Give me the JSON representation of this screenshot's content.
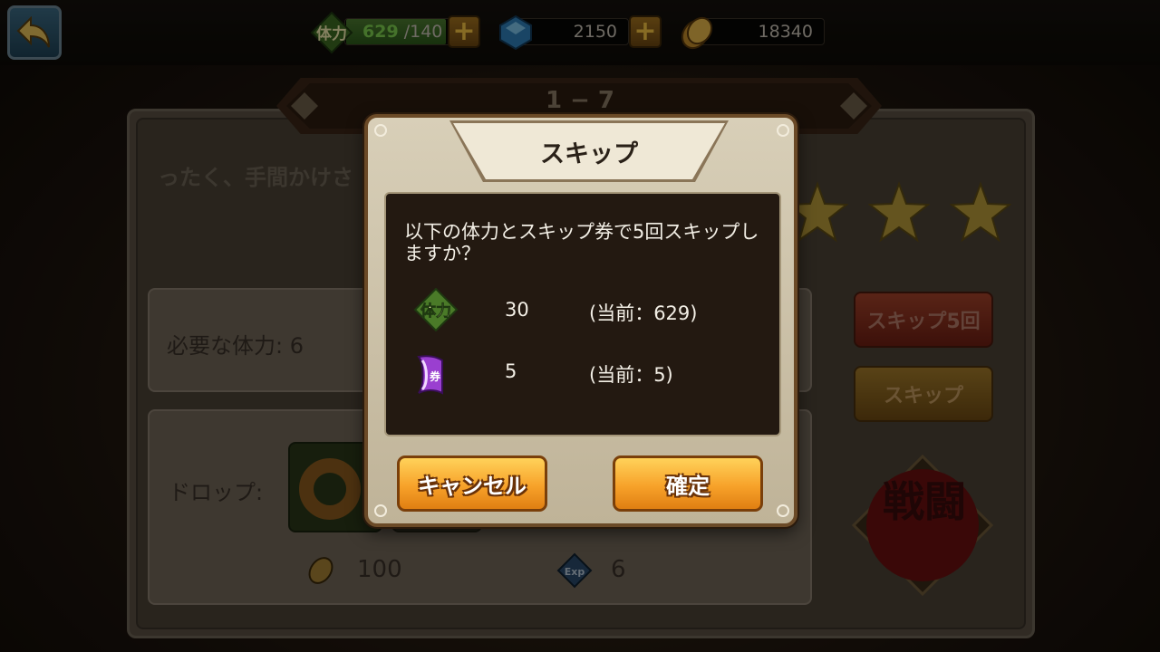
{
  "topbar": {
    "back_label": "↩",
    "stamina_current": "629",
    "stamina_max": "/140",
    "gems": "2150",
    "coins": "18340",
    "plus": "+",
    "stamina_icon_text": "体力"
  },
  "stage": {
    "number": "1 − 7",
    "description": "ったく、手間かけさ",
    "required_label": "必要な体力: 6",
    "drop_label": "ドロップ:",
    "gold_reward": "100",
    "exp_reward": "6",
    "stars": 3,
    "skip5_label": "スキップ5回",
    "skip_label": "スキップ",
    "battle_label": "戦闘"
  },
  "dialog": {
    "title": "スキップ",
    "message": "以下の体力とスキップ券で5回スキップしますか？",
    "stamina_icon_text": "体力",
    "stamina_cost": "30",
    "stamina_current": "(当前：629)",
    "ticket_cost": "5",
    "ticket_current": "(当前：5)",
    "cancel_label": "キャンセル",
    "confirm_label": "確定"
  },
  "colors": {
    "accent_orange": "#f7a22a",
    "stamina_green": "#7ed04f",
    "dialog_bg": "#231911"
  }
}
